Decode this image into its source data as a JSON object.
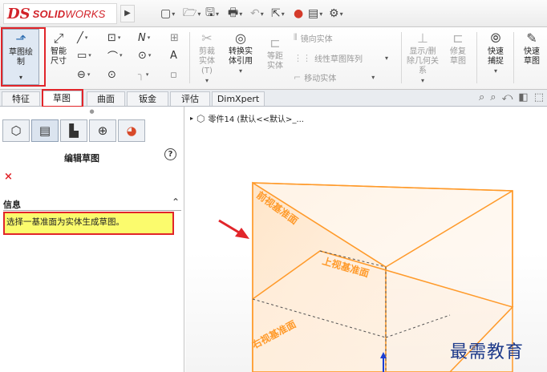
{
  "app": {
    "logo_mark": "DS",
    "logo_text_bold": "SOLID",
    "logo_text": "WORKS",
    "flyout": "▶"
  },
  "quick_access": [
    {
      "name": "new-document-icon",
      "glyph": "▢"
    },
    {
      "name": "open-folder-icon",
      "glyph": "🗁"
    },
    {
      "name": "save-icon",
      "glyph": "🖫"
    },
    {
      "name": "print-icon",
      "glyph": "🖶"
    },
    {
      "name": "undo-icon",
      "glyph": "↶"
    },
    {
      "name": "select-cursor-icon",
      "glyph": "⇱"
    },
    {
      "name": "rebuild-traffic-light-icon",
      "glyph": "●"
    },
    {
      "name": "file-properties-icon",
      "glyph": "▤"
    },
    {
      "name": "options-gear-icon",
      "glyph": "⚙"
    }
  ],
  "commands": {
    "sketch": "草图绘制",
    "smart_dimension": "智能尺寸",
    "trim": "剪裁实体(T)",
    "convert": "转换实体引用",
    "offset": "等距实体",
    "mirror": "镜向实体",
    "linear_pattern": "线性草图阵列",
    "move": "移动实体",
    "display_relations": "显示/删除几何关系",
    "repair": "修复草图",
    "quick_snaps": "快速捕捉",
    "rapid_sketch": "快速草图"
  },
  "tabs": [
    {
      "label": "特征",
      "active": false
    },
    {
      "label": "草图",
      "active": true
    },
    {
      "label": "曲面",
      "active": false
    },
    {
      "label": "钣金",
      "active": false
    },
    {
      "label": "评估",
      "active": false
    },
    {
      "label": "DimXpert",
      "active": false
    }
  ],
  "panel": {
    "title": "编辑草图",
    "help": "?",
    "cancel": "×",
    "info_heading": "信息",
    "info_text": "选择一基准面为实体生成草图。"
  },
  "tree": {
    "root": "零件14  (默认<<默认>_..."
  },
  "planes": {
    "front": "前视基准面",
    "top": "上视基准面",
    "right": "右视基准面"
  },
  "watermark": "最需教育",
  "colors": {
    "highlight": "#e1252a",
    "plane": "#ff9a2a",
    "info_bg": "#fbfb6d"
  }
}
